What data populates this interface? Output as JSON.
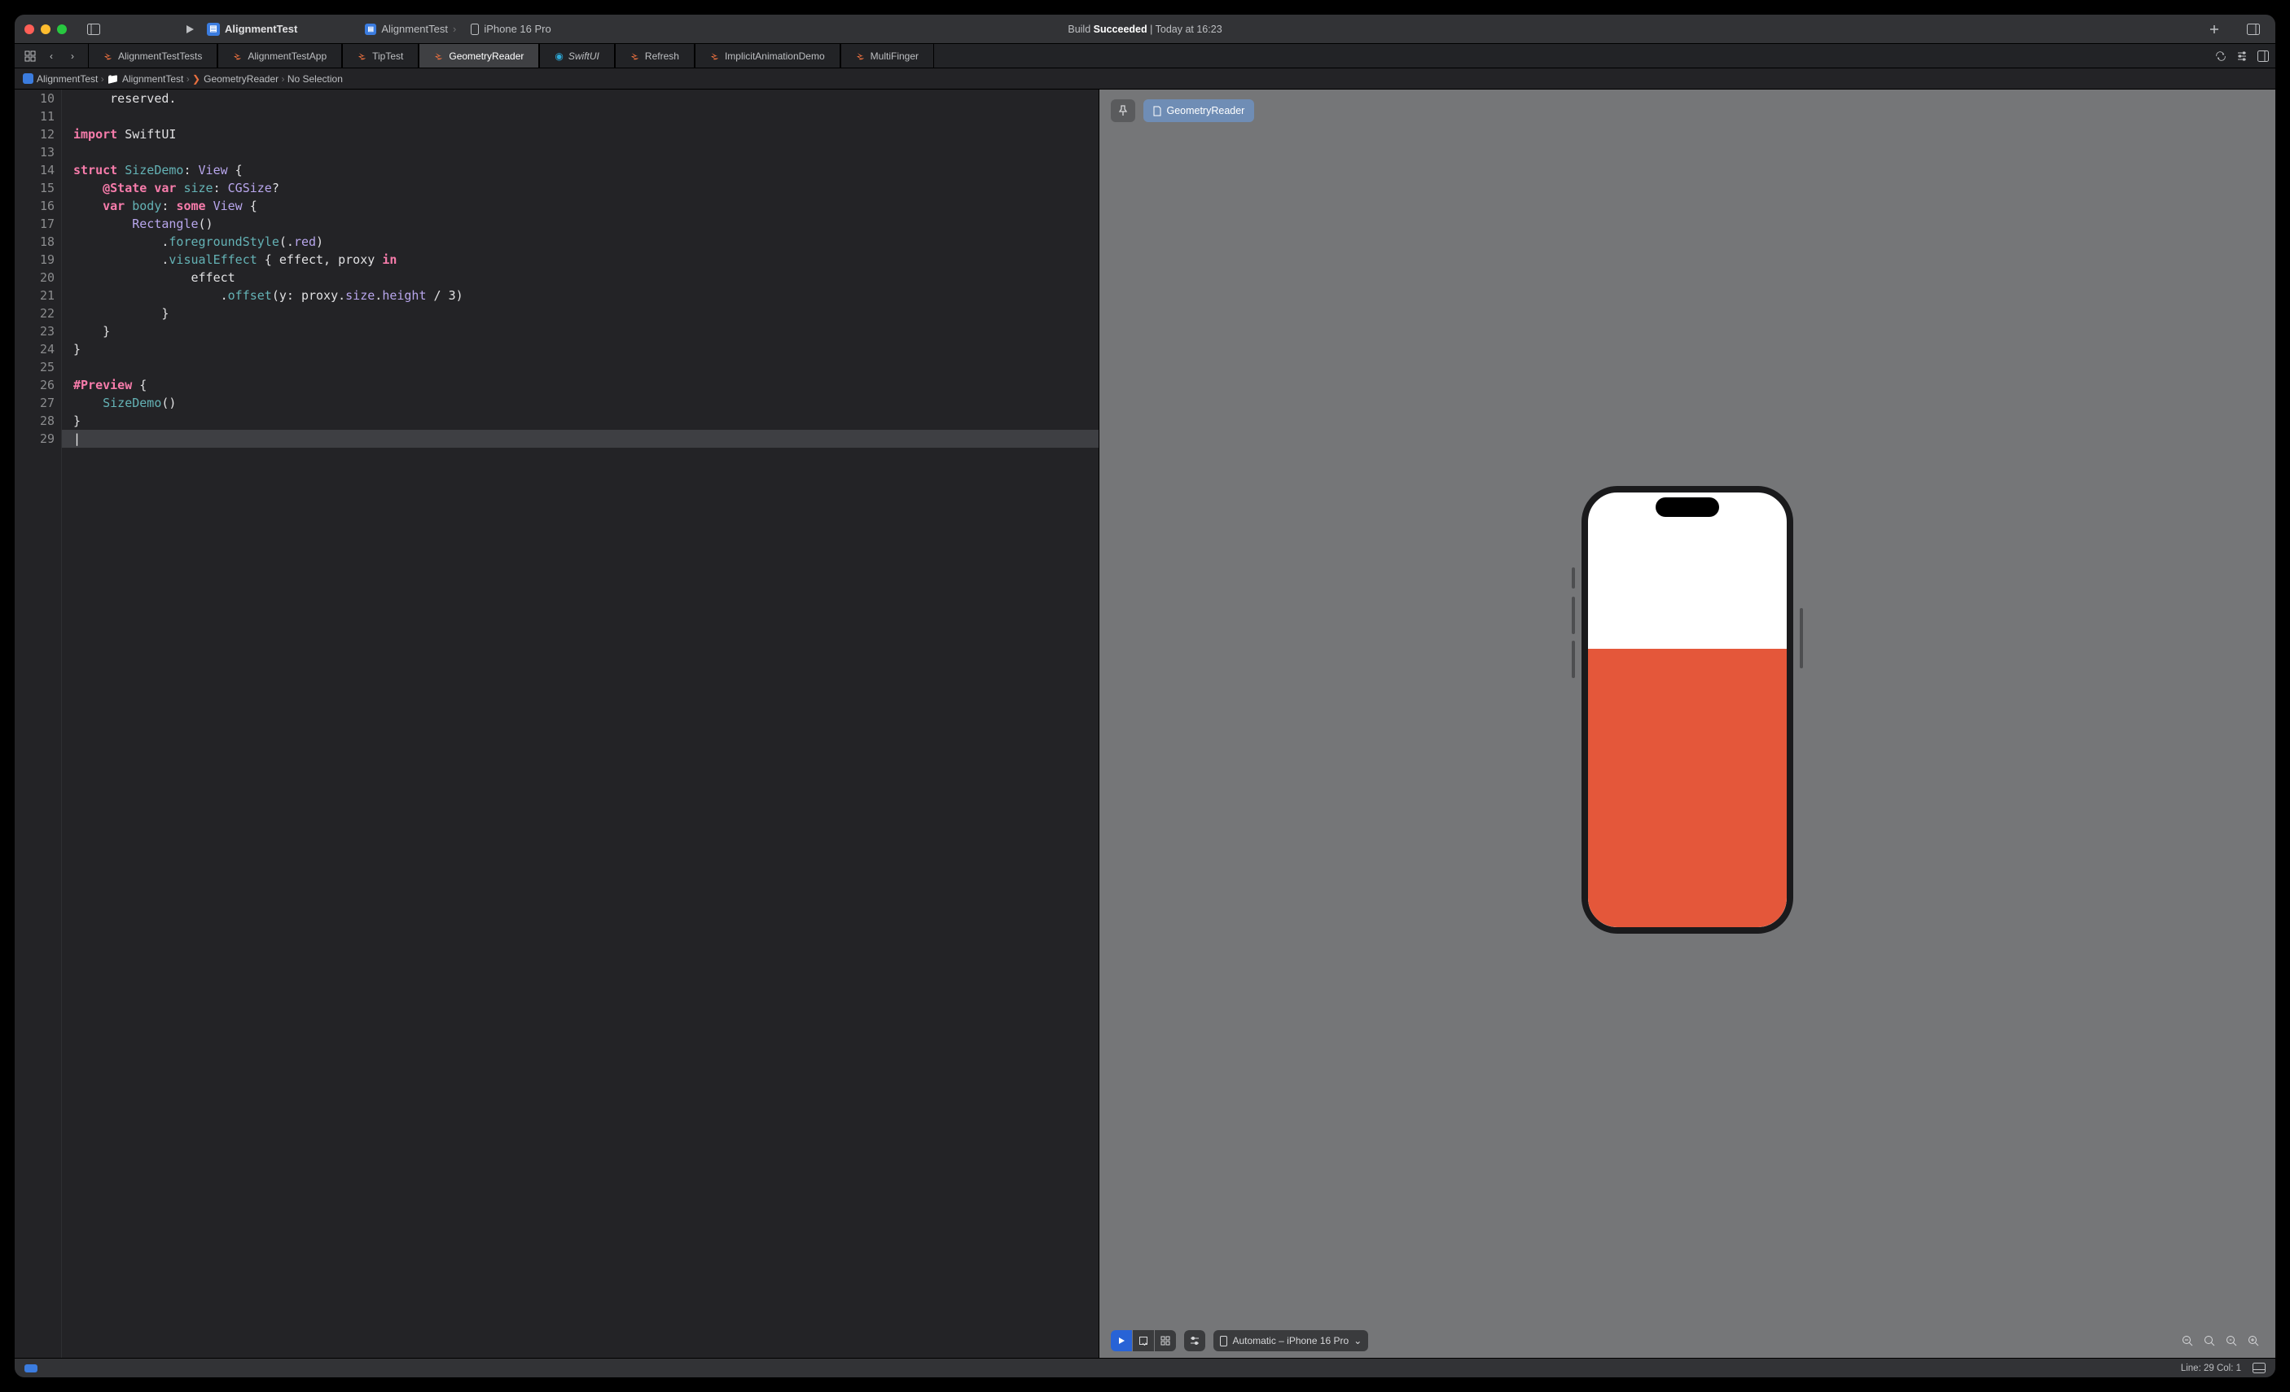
{
  "project_name": "AlignmentTest",
  "device_scheme": {
    "project": "AlignmentTest",
    "device": "iPhone 16 Pro"
  },
  "build_status": {
    "prefix": "Build",
    "state": "Succeeded",
    "separator": "|",
    "timestamp": "Today at 16:23"
  },
  "tabs": [
    {
      "label": "AlignmentTestTests",
      "icon": "swift"
    },
    {
      "label": "AlignmentTestApp",
      "icon": "swift"
    },
    {
      "label": "TipTest",
      "icon": "swift"
    },
    {
      "label": "GeometryReader",
      "icon": "swift",
      "active": true
    },
    {
      "label": "SwiftUI",
      "icon": "swiftui",
      "style": "italic"
    },
    {
      "label": "Refresh",
      "icon": "swift"
    },
    {
      "label": "ImplicitAnimationDemo",
      "icon": "swift"
    },
    {
      "label": "MultiFinger",
      "icon": "swift"
    }
  ],
  "breadcrumb": [
    {
      "label": "AlignmentTest",
      "icon": "app"
    },
    {
      "label": "AlignmentTest",
      "icon": "folder"
    },
    {
      "label": "GeometryReader",
      "icon": "swift"
    },
    {
      "label": "No Selection"
    }
  ],
  "code": {
    "first_line": 10,
    "tokens": [
      [
        {
          "t": "plain",
          "v": "     reserved."
        }
      ],
      [
        {
          "t": "plain",
          "v": ""
        }
      ],
      [
        {
          "t": "kw",
          "v": "import"
        },
        {
          "t": "plain",
          "v": " "
        },
        {
          "t": "plain",
          "v": "SwiftUI"
        }
      ],
      [
        {
          "t": "plain",
          "v": ""
        }
      ],
      [
        {
          "t": "kw",
          "v": "struct"
        },
        {
          "t": "plain",
          "v": " "
        },
        {
          "t": "id",
          "v": "SizeDemo"
        },
        {
          "t": "plain",
          "v": ": "
        },
        {
          "t": "ty",
          "v": "View"
        },
        {
          "t": "plain",
          "v": " {"
        }
      ],
      [
        {
          "t": "plain",
          "v": "    "
        },
        {
          "t": "kw",
          "v": "@State"
        },
        {
          "t": "plain",
          "v": " "
        },
        {
          "t": "kw",
          "v": "var"
        },
        {
          "t": "plain",
          "v": " "
        },
        {
          "t": "id",
          "v": "size"
        },
        {
          "t": "plain",
          "v": ": "
        },
        {
          "t": "ty",
          "v": "CGSize"
        },
        {
          "t": "plain",
          "v": "?"
        }
      ],
      [
        {
          "t": "plain",
          "v": "    "
        },
        {
          "t": "kw",
          "v": "var"
        },
        {
          "t": "plain",
          "v": " "
        },
        {
          "t": "id",
          "v": "body"
        },
        {
          "t": "plain",
          "v": ": "
        },
        {
          "t": "kw",
          "v": "some"
        },
        {
          "t": "plain",
          "v": " "
        },
        {
          "t": "ty",
          "v": "View"
        },
        {
          "t": "plain",
          "v": " {"
        }
      ],
      [
        {
          "t": "plain",
          "v": "        "
        },
        {
          "t": "ty",
          "v": "Rectangle"
        },
        {
          "t": "plain",
          "v": "()"
        }
      ],
      [
        {
          "t": "plain",
          "v": "            ."
        },
        {
          "t": "id",
          "v": "foregroundStyle"
        },
        {
          "t": "plain",
          "v": "(."
        },
        {
          "t": "ty",
          "v": "red"
        },
        {
          "t": "plain",
          "v": ")"
        }
      ],
      [
        {
          "t": "plain",
          "v": "            ."
        },
        {
          "t": "id",
          "v": "visualEffect"
        },
        {
          "t": "plain",
          "v": " { effect, proxy "
        },
        {
          "t": "kw",
          "v": "in"
        }
      ],
      [
        {
          "t": "plain",
          "v": "                effect"
        }
      ],
      [
        {
          "t": "plain",
          "v": "                    ."
        },
        {
          "t": "id",
          "v": "offset"
        },
        {
          "t": "plain",
          "v": "(y: proxy."
        },
        {
          "t": "ty",
          "v": "size"
        },
        {
          "t": "plain",
          "v": "."
        },
        {
          "t": "ty",
          "v": "height"
        },
        {
          "t": "plain",
          "v": " / 3)"
        }
      ],
      [
        {
          "t": "plain",
          "v": "            }"
        }
      ],
      [
        {
          "t": "plain",
          "v": "    }"
        }
      ],
      [
        {
          "t": "plain",
          "v": "}"
        }
      ],
      [
        {
          "t": "plain",
          "v": ""
        }
      ],
      [
        {
          "t": "kw",
          "v": "#Preview"
        },
        {
          "t": "plain",
          "v": " {"
        }
      ],
      [
        {
          "t": "plain",
          "v": "    "
        },
        {
          "t": "id",
          "v": "SizeDemo"
        },
        {
          "t": "plain",
          "v": "()"
        }
      ],
      [
        {
          "t": "plain",
          "v": "}"
        }
      ],
      [
        {
          "t": "plain",
          "v": ""
        }
      ]
    ],
    "selected_line": 29
  },
  "canvas": {
    "pill_label": "GeometryReader",
    "device_label": "Automatic – iPhone 16 Pro"
  },
  "statusbar": {
    "line_col": "Line: 29  Col: 1"
  }
}
